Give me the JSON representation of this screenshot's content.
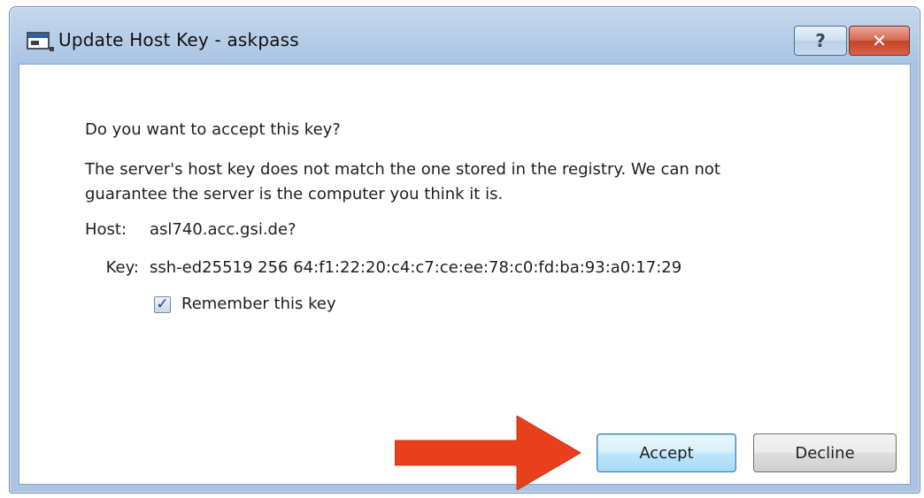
{
  "window": {
    "title": "Update Host Key - askpass",
    "help_label": "?",
    "close_label": "✕"
  },
  "dialog": {
    "question": "Do you want to accept this key?",
    "warning_line1": "The server's host key does not match the one stored in the registry. We can not",
    "warning_line2": "guarantee the server is the computer you think it is.",
    "host_label": "Host:",
    "host_value": "asl740.acc.gsi.de?",
    "key_label": "Key:",
    "key_value": "ssh-ed25519 256 64:f1:22:20:c4:c7:ce:ee:78:c0:fd:ba:93:a0:17:29",
    "remember_label": "Remember this key",
    "remember_checked": true
  },
  "buttons": {
    "accept_label": "Accept",
    "decline_label": "Decline"
  },
  "colors": {
    "arrow": "#e8401c",
    "accept_focus": "#3c7fb1",
    "close_button": "#c5432a"
  },
  "icons": {
    "app": "window-app-icon",
    "help": "help-icon",
    "close": "close-icon",
    "check": "checkmark-icon",
    "annotation": "arrow-icon"
  }
}
